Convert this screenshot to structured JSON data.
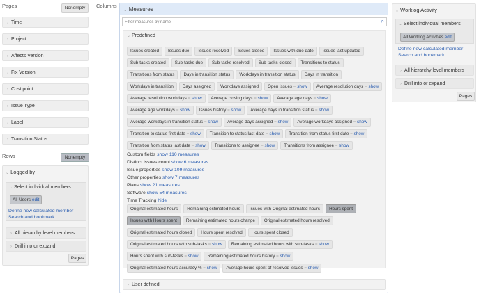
{
  "left": {
    "pages_label": "Pages",
    "nonempty": "Nonempty",
    "page_dims": [
      "Time",
      "Project",
      "Affects Version",
      "Fix Version",
      "Cost point",
      "Issue Type",
      "Label",
      "Transition Status"
    ],
    "rows_label": "Rows",
    "rows_nonempty": "Nonempty",
    "logged_by": "Logged by",
    "select_individual": "Select individual members",
    "all_users": "All Users",
    "edit": "edit",
    "define_calc": "Define new calculated member",
    "search_bookmark": "Search and bookmark",
    "all_hierarchy": "All hierarchy level members",
    "drill": "Drill into or expand",
    "pages_btn": "Pages"
  },
  "columns_label": "Columns",
  "measures": {
    "title": "Measures",
    "filter_placeholder": "Filter measures by name",
    "predefined": "Predefined",
    "rows": [
      [
        {
          "t": "Issues created"
        },
        {
          "t": "Issues due"
        },
        {
          "t": "Issues resolved"
        },
        {
          "t": "Issues closed"
        },
        {
          "t": "Issues with due date"
        },
        {
          "t": "Issues last updated"
        }
      ],
      [
        {
          "t": "Sub-tasks created"
        },
        {
          "t": "Sub-tasks due"
        },
        {
          "t": "Sub-tasks resolved"
        },
        {
          "t": "Sub-tasks closed"
        },
        {
          "t": "Transitions to status"
        }
      ],
      [
        {
          "t": "Transitions from status"
        },
        {
          "t": "Days in transition status"
        },
        {
          "t": "Workdays in transition status"
        },
        {
          "t": "Days in transition"
        }
      ],
      [
        {
          "t": "Workdays in transition"
        },
        {
          "t": "Days assigned"
        },
        {
          "t": "Workdays assigned"
        },
        {
          "t": "Open issues",
          "s": "show"
        },
        {
          "t": "Average resolution days",
          "s": "show"
        }
      ],
      [
        {
          "t": "Average resolution workdays",
          "s": "show"
        },
        {
          "t": "Average closing days",
          "s": "show"
        },
        {
          "t": "Average age days",
          "s": "show"
        }
      ],
      [
        {
          "t": "Average age workdays",
          "s": "show"
        },
        {
          "t": "Issues history",
          "s": "show"
        },
        {
          "t": "Average days in transition status",
          "s": "show"
        }
      ],
      [
        {
          "t": "Average workdays in transition status",
          "s": "show"
        },
        {
          "t": "Average days assigned",
          "s": "show"
        },
        {
          "t": "Average workdays assigned",
          "s": "show"
        }
      ],
      [
        {
          "t": "Transition to status first date",
          "s": "show"
        },
        {
          "t": "Transition to status last date",
          "s": "show"
        },
        {
          "t": "Transition from status first date",
          "s": "show"
        }
      ],
      [
        {
          "t": "Transition from status last date",
          "s": "show"
        },
        {
          "t": "Transitions to assignee",
          "s": "show"
        },
        {
          "t": "Transitions from assignee",
          "s": "show"
        }
      ]
    ],
    "groups": [
      {
        "label": "Custom fields",
        "link": "show 110 measures"
      },
      {
        "label": "Distinct issues count",
        "link": "show 6 measures"
      },
      {
        "label": "Issue properties",
        "link": "show 109 measures"
      },
      {
        "label": "Other properties",
        "link": "show 7 measures"
      },
      {
        "label": "Plans",
        "link": "show 21 measures"
      },
      {
        "label": "Software",
        "link": "show 54 measures"
      },
      {
        "label": "Time Tracking",
        "link": "hide"
      }
    ],
    "tt_rows": [
      [
        {
          "t": "Original estimated hours"
        },
        {
          "t": "Remaining estimated hours"
        },
        {
          "t": "Issues with Original estimated hours"
        },
        {
          "t": "Hours spent",
          "sel": true
        }
      ],
      [
        {
          "t": "Issues with Hours spent",
          "sel": true
        },
        {
          "t": "Remaining estimated hours change"
        },
        {
          "t": "Original estimated hours resolved"
        }
      ],
      [
        {
          "t": "Original estimated hours closed"
        },
        {
          "t": "Hours spent resolved"
        },
        {
          "t": "Hours spent closed"
        }
      ],
      [
        {
          "t": "Original estimated hours with sub-tasks",
          "s": "show"
        },
        {
          "t": "Remaining estimated hours with sub-tasks",
          "s": "show"
        }
      ],
      [
        {
          "t": "Hours spent with sub-tasks",
          "s": "show"
        },
        {
          "t": "Remaining estimated hours history",
          "s": "show"
        }
      ],
      [
        {
          "t": "Original estimated hours accuracy %",
          "s": "show"
        },
        {
          "t": "Average hours spent of resolved issues",
          "s": "show"
        }
      ]
    ],
    "user_defined": "User defined"
  },
  "right": {
    "title": "Worklog Activity",
    "select_individual": "Select individual members",
    "all_worklog": "All Worklog Activities",
    "edit": "edit",
    "define_calc": "Define new calculated member",
    "search_bookmark": "Search and bookmark",
    "all_hierarchy": "All hierarchy level members",
    "drill": "Drill into or expand",
    "pages_btn": "Pages"
  }
}
